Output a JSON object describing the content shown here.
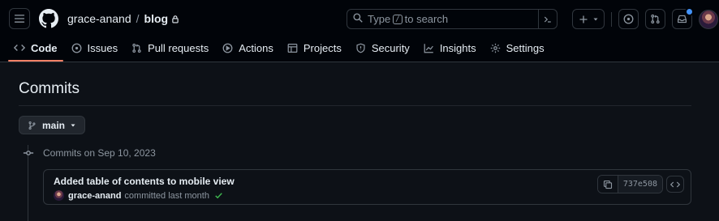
{
  "header": {
    "owner": "grace-anand",
    "separator": "/",
    "repo": "blog",
    "search": {
      "prefix": "Type",
      "key": "/",
      "suffix": "to search"
    }
  },
  "tabs": [
    {
      "label": "Code",
      "icon": "code-icon",
      "active": true
    },
    {
      "label": "Issues",
      "icon": "issue-icon"
    },
    {
      "label": "Pull requests",
      "icon": "pull-request-icon"
    },
    {
      "label": "Actions",
      "icon": "play-icon"
    },
    {
      "label": "Projects",
      "icon": "table-icon"
    },
    {
      "label": "Security",
      "icon": "shield-icon"
    },
    {
      "label": "Insights",
      "icon": "graph-icon"
    },
    {
      "label": "Settings",
      "icon": "gear-icon"
    }
  ],
  "page": {
    "title": "Commits",
    "branch": "main"
  },
  "commit_groups": [
    {
      "heading": "Commits on Sep 10, 2023",
      "commits": [
        {
          "message": "Added table of contents to mobile view",
          "author": "grace-anand",
          "action": "committed last month",
          "sha": "737e508",
          "verified_check": true
        }
      ]
    }
  ],
  "colors": {
    "background": "#0d1117",
    "header": "#010409",
    "border": "#30363d",
    "active_tab_underline": "#f78166",
    "notification_dot": "#4493f8",
    "check": "#3fb950"
  }
}
